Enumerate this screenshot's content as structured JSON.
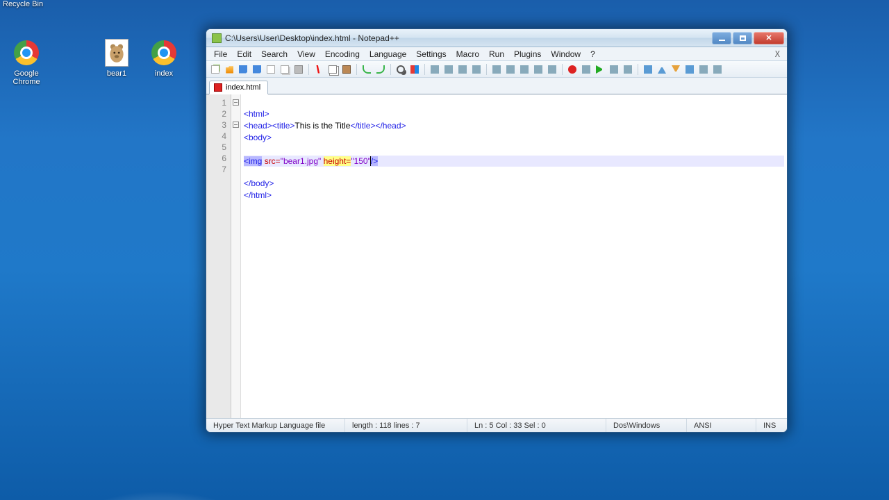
{
  "desktop": {
    "icons": {
      "recycle_bin": "Recycle Bin",
      "chrome": "Google Chrome",
      "bear1": "bear1",
      "index": "index"
    }
  },
  "window": {
    "title": "C:\\Users\\User\\Desktop\\index.html - Notepad++",
    "menus": [
      "File",
      "Edit",
      "Search",
      "View",
      "Encoding",
      "Language",
      "Settings",
      "Macro",
      "Run",
      "Plugins",
      "Window",
      "?"
    ],
    "tab_label": "index.html",
    "doc_close": "X"
  },
  "code": {
    "line_numbers": [
      "1",
      "2",
      "3",
      "4",
      "5",
      "6",
      "7"
    ],
    "l1": {
      "open": "<html>"
    },
    "l2": {
      "a": "<head><title>",
      "t": "This is the Title",
      "b": "</title></head>"
    },
    "l3": {
      "open": "<body>"
    },
    "l4": {
      "blank": ""
    },
    "l5": {
      "tag_open": "<img",
      "sp1": " ",
      "attr1": "src=",
      "val1": "\"bear1.jpg\"",
      "sp2": " ",
      "attr2": "height=",
      "val2": "\"150\"",
      "tag_close": "/>"
    },
    "l6": {
      "close": "</body>"
    },
    "l7": {
      "close": "</html>"
    }
  },
  "status": {
    "file_type": "Hyper Text Markup Language file",
    "length_lines": "length : 118    lines : 7",
    "caret": "Ln : 5    Col : 33    Sel : 0",
    "eol": "Dos\\Windows",
    "encoding": "ANSI",
    "mode": "INS"
  }
}
